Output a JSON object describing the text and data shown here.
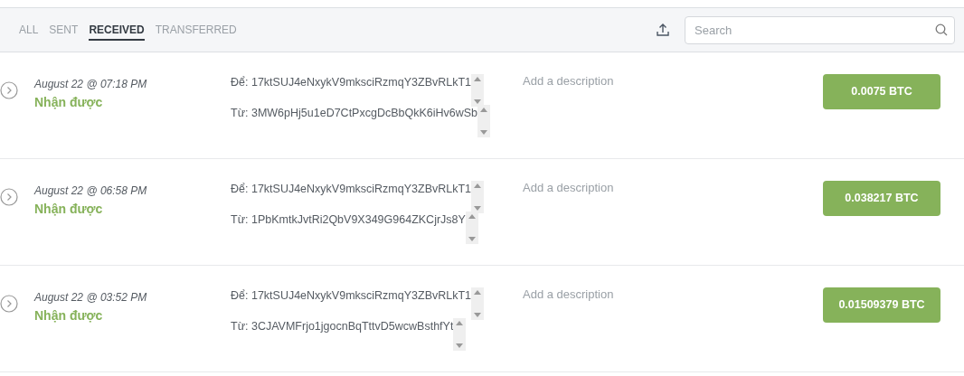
{
  "tabs": [
    {
      "label": "ALL",
      "selected": false
    },
    {
      "label": "SENT",
      "selected": false
    },
    {
      "label": "RECEIVED",
      "selected": true
    },
    {
      "label": "TRANSFERRED",
      "selected": false
    }
  ],
  "search": {
    "placeholder": "Search"
  },
  "transactions": [
    {
      "date": "August 22 @ 07:18 PM",
      "status": "Nhận được",
      "to": "Để: 17ktSUJ4eNxykV9mksciRzmqY3ZBvRLkT1",
      "from": "Từ: 3MW6pHj5u1eD7CtPxcgDcBbQkK6iHv6wSb",
      "description_placeholder": "Add a description",
      "amount": "0.0075 BTC"
    },
    {
      "date": "August 22 @ 06:58 PM",
      "status": "Nhận được",
      "to": "Để: 17ktSUJ4eNxykV9mksciRzmqY3ZBvRLkT1",
      "from": "Từ: 1PbKmtkJvtRi2QbV9X349G964ZKCjrJs8Y",
      "description_placeholder": "Add a description",
      "amount": "0.038217 BTC"
    },
    {
      "date": "August 22 @ 03:52 PM",
      "status": "Nhận được",
      "to": "Để: 17ktSUJ4eNxykV9mksciRzmqY3ZBvRLkT1",
      "from": "Từ: 3CJAVMFrjo1jgocnBqTttvD5wcwBsthfYt",
      "description_placeholder": "Add a description",
      "amount": "0.01509379 BTC"
    }
  ]
}
